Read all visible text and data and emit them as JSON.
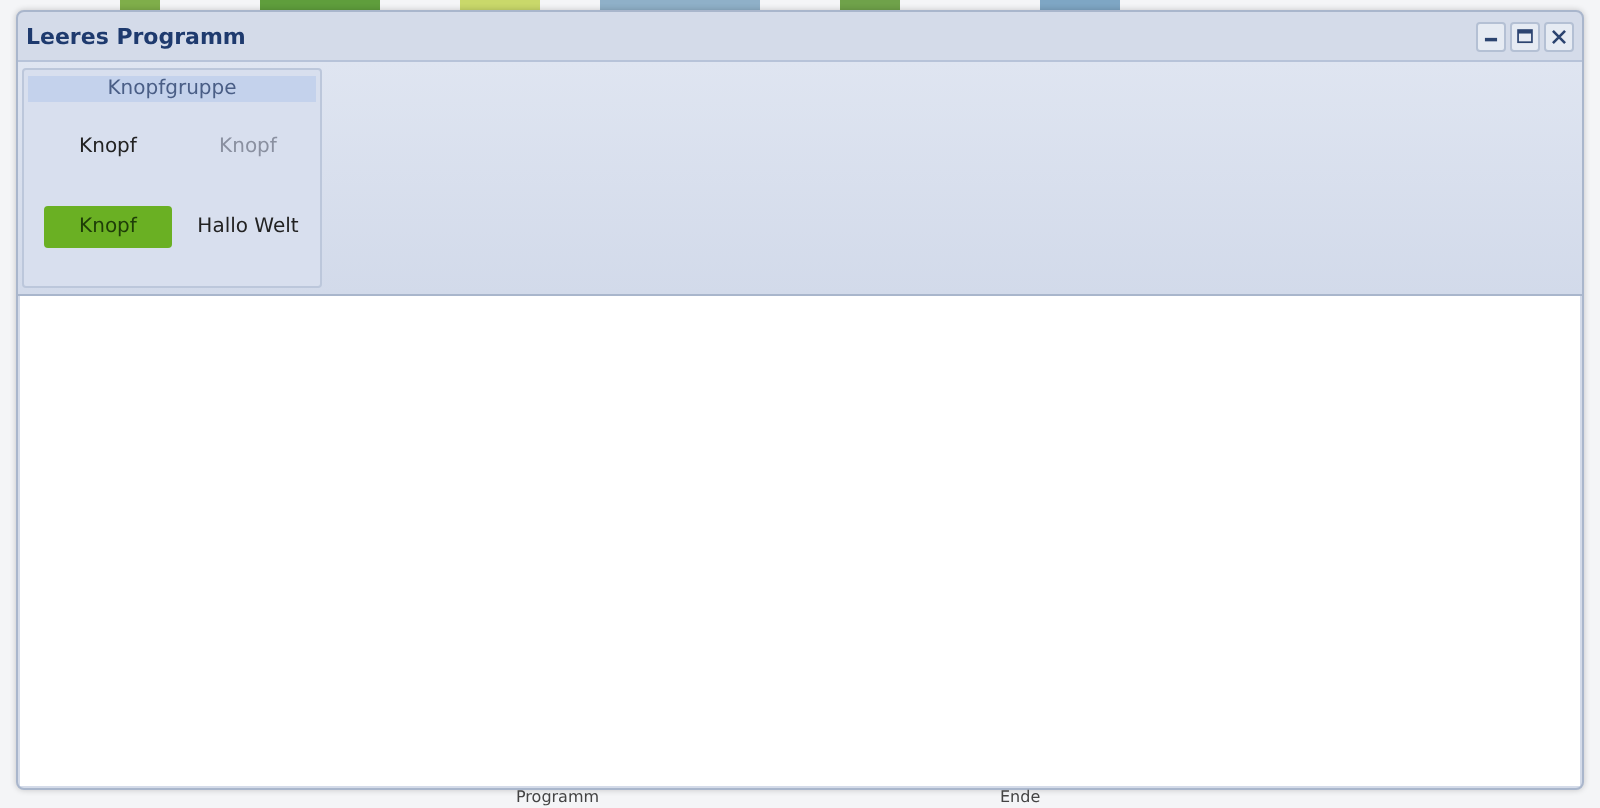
{
  "window": {
    "title": "Leeres Programm"
  },
  "ribbon": {
    "group": {
      "title": "Knopfgruppe",
      "buttons": [
        {
          "label": "Knopf",
          "disabled": false,
          "pressed": false
        },
        {
          "label": "Knopf",
          "disabled": true,
          "pressed": false
        },
        {
          "label": "Knopf",
          "disabled": false,
          "pressed": true
        },
        {
          "label": "Hallo Welt",
          "disabled": false,
          "pressed": false
        }
      ]
    }
  },
  "desktop": {
    "icons": [
      {
        "label": "Programm"
      },
      {
        "label": "Ende"
      }
    ]
  }
}
